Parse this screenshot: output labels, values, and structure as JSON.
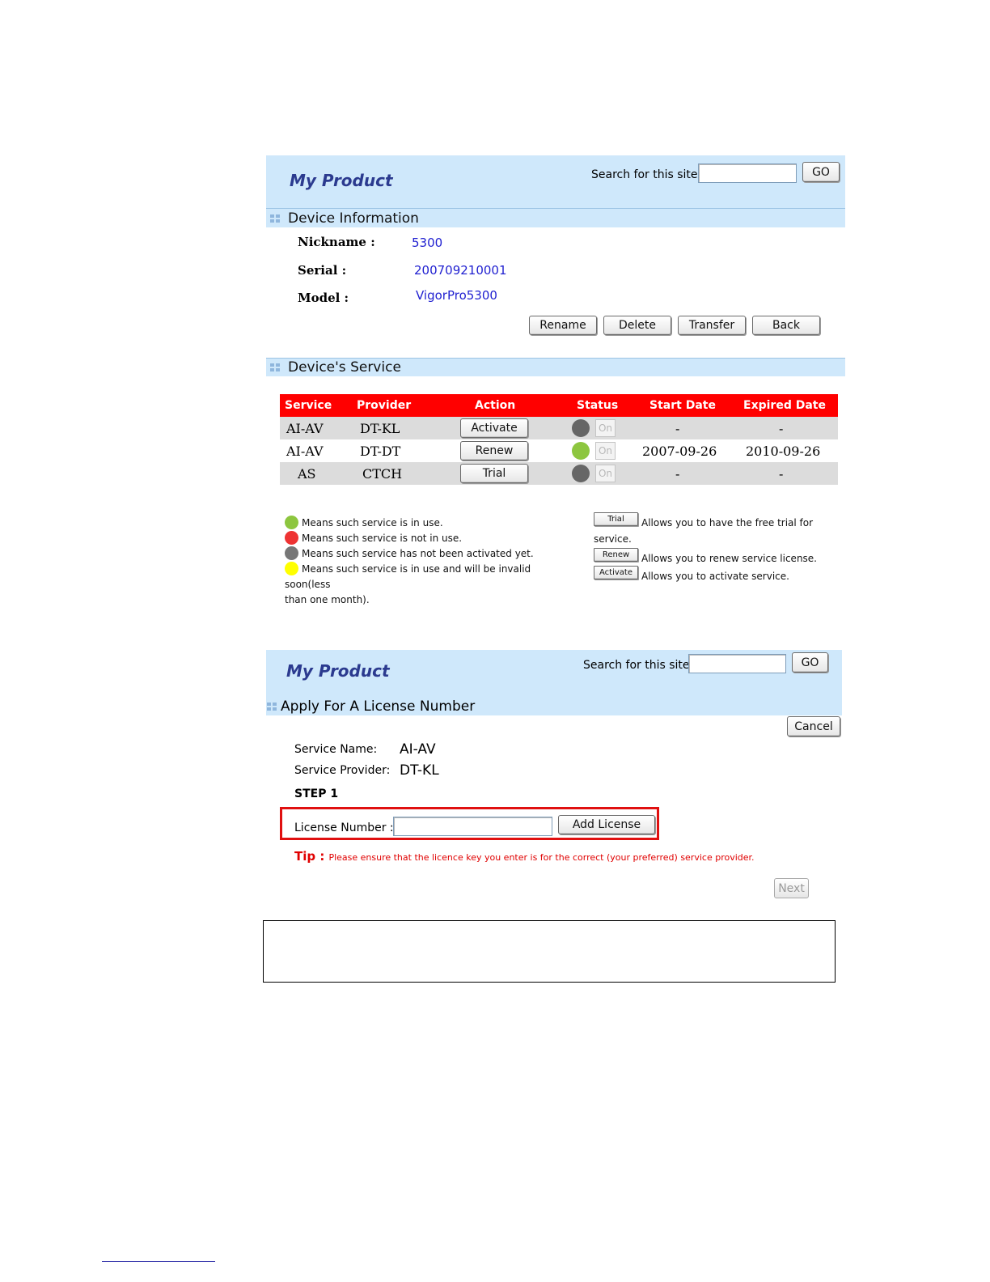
{
  "panel1": {
    "brand": "My Product",
    "search_label": "Search for this site",
    "search_value": "",
    "go_label": "GO",
    "device_info": {
      "title": "Device Information",
      "nickname_label": "Nickname :",
      "nickname_value": "5300",
      "serial_label": "Serial :",
      "serial_value": "200709210001",
      "model_label": "Model :",
      "model_value": "VigorPro5300"
    },
    "buttons": {
      "rename": "Rename",
      "delete": "Delete",
      "transfer": "Transfer",
      "back": "Back"
    },
    "device_service": {
      "title": "Device's Service",
      "headers": [
        "Service",
        "Provider",
        "Action",
        "Status",
        "Start Date",
        "Expired Date"
      ],
      "rows": [
        {
          "service": "AI-AV",
          "provider": "DT-KL",
          "action": "Activate",
          "status_color": "#666666",
          "status_text": "On",
          "start": "-",
          "expired": "-"
        },
        {
          "service": "AI-AV",
          "provider": "DT-DT",
          "action": "Renew",
          "status_color": "#8dc63f",
          "status_text": "On",
          "start": "2007-09-26",
          "expired": "2010-09-26"
        },
        {
          "service": "AS",
          "provider": "CTCH",
          "action": "Trial",
          "status_color": "#666666",
          "status_text": "On",
          "start": "-",
          "expired": "-"
        }
      ]
    },
    "legend": {
      "items": [
        {
          "color": "#8dc63f",
          "text": "Means such service is in use."
        },
        {
          "color": "#ee3333",
          "text": "Means such service is not in use."
        },
        {
          "color": "#777777",
          "text": "Means such service has not been activated yet."
        },
        {
          "color": "#ffff00",
          "text": "Means such service is in use and will be invalid soon(less"
        }
      ],
      "wrap_text": "than one month).",
      "trial_button": "Trial",
      "trial_text": "Allows you to have the free trial for",
      "trial_wrap": "service.",
      "renew_button": "Renew",
      "renew_text": "Allows you to renew service license.",
      "activate_button": "Activate",
      "activate_text": "Allows you to activate service."
    }
  },
  "panel2": {
    "brand": "My Product",
    "search_label": "Search for this site",
    "search_value": "",
    "go_label": "GO",
    "section_title": "Apply For A License Number",
    "cancel_label": "Cancel",
    "service_name_label": "Service Name:",
    "service_name_value": "AI-AV",
    "service_provider_label": "Service Provider:",
    "service_provider_value": "DT-KL",
    "step_label": "STEP 1",
    "license_label": "License Number :",
    "license_value": "",
    "add_license_label": "Add License",
    "tip_label": "Tip :",
    "tip_text": "Please ensure that the licence key you enter is for the correct (your preferred) service provider.",
    "next_label": "Next"
  },
  "colors": {
    "header_bg": "#cfe8fb",
    "brand": "#2b3a8f",
    "link_value": "#1f1fd0",
    "table_header": "#ff0000",
    "table_alt_row": "#dcdcdc",
    "highlight_red": "#e01010"
  }
}
